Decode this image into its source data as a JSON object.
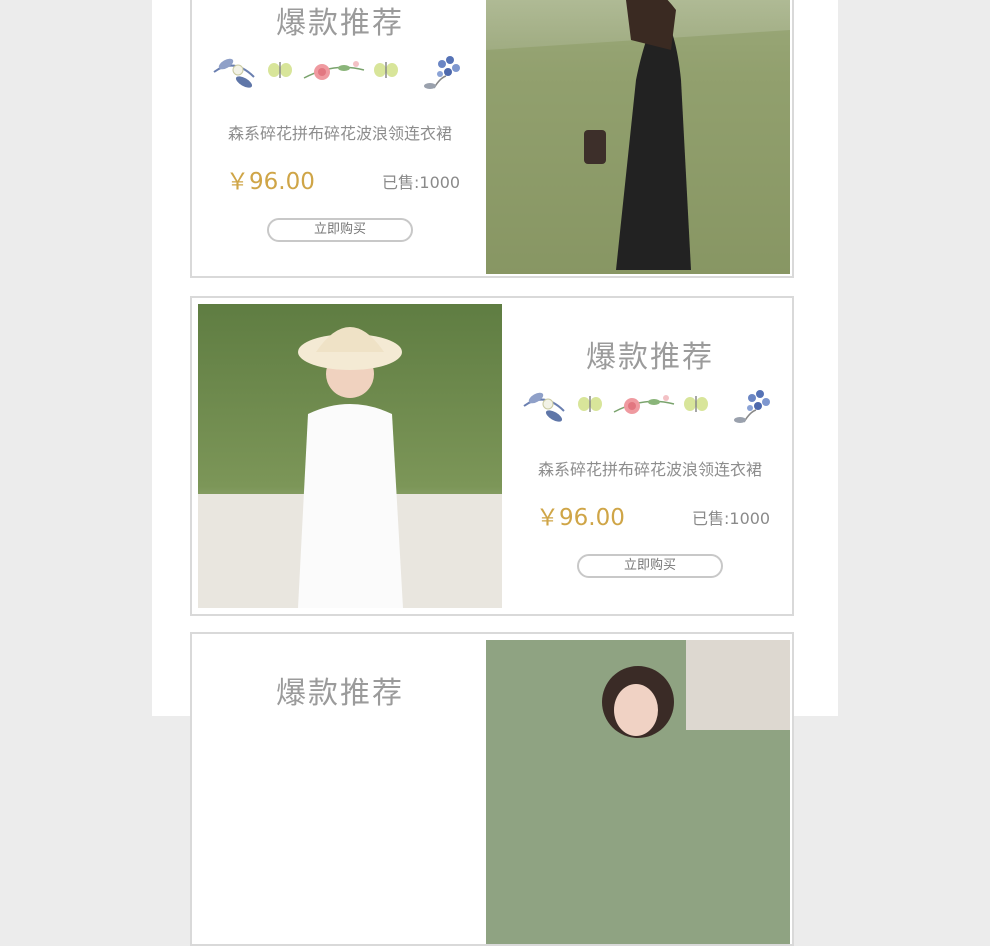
{
  "products": [
    {
      "section_title": "爆款推荐",
      "name": "森系碎花拼布碎花波浪领连衣裙",
      "price": "￥96.00",
      "sold": "已售:1000",
      "buy_label": "立即购买"
    },
    {
      "section_title": "爆款推荐",
      "name": "森系碎花拼布碎花波浪领连衣裙",
      "price": "￥96.00",
      "sold": "已售:1000",
      "buy_label": "立即购买"
    },
    {
      "section_title": "爆款推荐"
    }
  ],
  "colors": {
    "price": "#cfa547",
    "border": "#d9d9d9",
    "background": "#ececec"
  },
  "icons": [
    "floral-decoration-icon",
    "butterfly-icon",
    "rose-icon",
    "hydrangea-icon"
  ]
}
